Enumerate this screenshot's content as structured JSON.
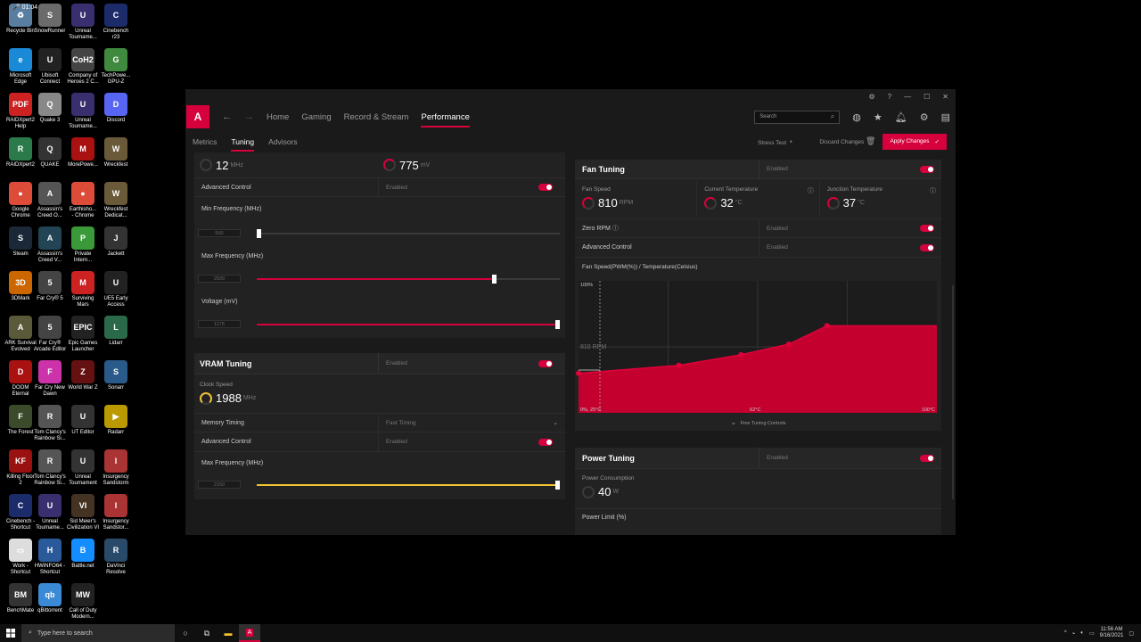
{
  "desktop": {
    "icons": [
      {
        "label": "Recycle Bin",
        "x": 3,
        "y": 4,
        "color": "#5a7ea0",
        "glyph": "♻"
      },
      {
        "label": "SnowRunner",
        "x": 36,
        "y": 4,
        "color": "#6b6b6b",
        "glyph": "S"
      },
      {
        "label": "Unreal\nTourname...",
        "x": 73,
        "y": 4,
        "color": "#3a2f6e",
        "glyph": "U"
      },
      {
        "label": "Cinebench\nr23",
        "x": 110,
        "y": 4,
        "color": "#1c2c6a",
        "glyph": "C"
      },
      {
        "label": "Microsoft\nEdge",
        "x": 3,
        "y": 54,
        "color": "#1b8ad6",
        "glyph": "e"
      },
      {
        "label": "Ubisoft\nConnect",
        "x": 36,
        "y": 54,
        "color": "#222",
        "glyph": "U"
      },
      {
        "label": "Company of\nHeroes 2 C...",
        "x": 73,
        "y": 54,
        "color": "#444",
        "glyph": "CoH2"
      },
      {
        "label": "TechPowe...\nGPU-Z",
        "x": 110,
        "y": 54,
        "color": "#3f8a3f",
        "glyph": "G"
      },
      {
        "label": "RAIDXpert2\nHelp",
        "x": 3,
        "y": 104,
        "color": "#c22",
        "glyph": "PDF"
      },
      {
        "label": "Quake 3",
        "x": 36,
        "y": 104,
        "color": "#888",
        "glyph": "Q"
      },
      {
        "label": "Unreal\nTourname...",
        "x": 73,
        "y": 104,
        "color": "#3a2f6e",
        "glyph": "U"
      },
      {
        "label": "Discord",
        "x": 110,
        "y": 104,
        "color": "#5865f2",
        "glyph": "D"
      },
      {
        "label": "RAIDXpert2",
        "x": 3,
        "y": 154,
        "color": "#2a7a4a",
        "glyph": "R"
      },
      {
        "label": "QUAKE",
        "x": 36,
        "y": 154,
        "color": "#333",
        "glyph": "Q"
      },
      {
        "label": "MorePowe...",
        "x": 73,
        "y": 154,
        "color": "#a11",
        "glyph": "M"
      },
      {
        "label": "Wreckfest",
        "x": 110,
        "y": 154,
        "color": "#6a5a3a",
        "glyph": "W"
      },
      {
        "label": "Google\nChrome",
        "x": 3,
        "y": 204,
        "color": "#dd4b39",
        "glyph": "●"
      },
      {
        "label": "Assassin's\nCreed O...",
        "x": 36,
        "y": 204,
        "color": "#555",
        "glyph": "A"
      },
      {
        "label": "Earthisho...\n- Chrome",
        "x": 73,
        "y": 204,
        "color": "#dd4b39",
        "glyph": "●"
      },
      {
        "label": "Wreckfest\nDedicat...",
        "x": 110,
        "y": 204,
        "color": "#6a5a3a",
        "glyph": "W"
      },
      {
        "label": "Steam",
        "x": 3,
        "y": 254,
        "color": "#1b2838",
        "glyph": "S"
      },
      {
        "label": "Assassin's\nCreed V...",
        "x": 36,
        "y": 254,
        "color": "#245",
        "glyph": "A"
      },
      {
        "label": "Private\nIntern...",
        "x": 73,
        "y": 254,
        "color": "#3a9a3a",
        "glyph": "P"
      },
      {
        "label": "Jackett",
        "x": 110,
        "y": 254,
        "color": "#333",
        "glyph": "J"
      },
      {
        "label": "3DMark",
        "x": 3,
        "y": 304,
        "color": "#c60",
        "glyph": "3D"
      },
      {
        "label": "Far Cry® 5",
        "x": 36,
        "y": 304,
        "color": "#444",
        "glyph": "5"
      },
      {
        "label": "Surviving\nMars",
        "x": 73,
        "y": 304,
        "color": "#c22",
        "glyph": "M"
      },
      {
        "label": "UE5 Early\nAccess",
        "x": 110,
        "y": 304,
        "color": "#222",
        "glyph": "U"
      },
      {
        "label": "ARK Survival\nEvolved",
        "x": 3,
        "y": 354,
        "color": "#5a5a3a",
        "glyph": "A"
      },
      {
        "label": "Far Cry®\nArcade Editor",
        "x": 36,
        "y": 354,
        "color": "#444",
        "glyph": "5"
      },
      {
        "label": "Epic Games\nLauncher",
        "x": 73,
        "y": 354,
        "color": "#222",
        "glyph": "EPIC"
      },
      {
        "label": "Lidarr",
        "x": 110,
        "y": 354,
        "color": "#2a6a4a",
        "glyph": "L"
      },
      {
        "label": "DOOM\nEternal",
        "x": 3,
        "y": 404,
        "color": "#a11",
        "glyph": "D"
      },
      {
        "label": "Far Cry New\nDawn",
        "x": 36,
        "y": 404,
        "color": "#c3a",
        "glyph": "F"
      },
      {
        "label": "World War Z",
        "x": 73,
        "y": 404,
        "color": "#611",
        "glyph": "Z"
      },
      {
        "label": "Sonarr",
        "x": 110,
        "y": 404,
        "color": "#2a5a8a",
        "glyph": "S"
      },
      {
        "label": "The Forest",
        "x": 3,
        "y": 454,
        "color": "#3a4a2a",
        "glyph": "F"
      },
      {
        "label": "Tom Clancy's\nRainbow Si...",
        "x": 36,
        "y": 454,
        "color": "#555",
        "glyph": "R"
      },
      {
        "label": "UT Editor",
        "x": 73,
        "y": 454,
        "color": "#333",
        "glyph": "U"
      },
      {
        "label": "Radarr",
        "x": 110,
        "y": 454,
        "color": "#b90",
        "glyph": "▶"
      },
      {
        "label": "Killing Floor\n2",
        "x": 3,
        "y": 504,
        "color": "#911",
        "glyph": "KF"
      },
      {
        "label": "Tom Clancy's\nRainbow Si...",
        "x": 36,
        "y": 504,
        "color": "#555",
        "glyph": "R"
      },
      {
        "label": "Unreal\nTournament",
        "x": 73,
        "y": 504,
        "color": "#333",
        "glyph": "U"
      },
      {
        "label": "Insurgency\nSandstorm",
        "x": 110,
        "y": 504,
        "color": "#a33",
        "glyph": "I"
      },
      {
        "label": "Cinebench -\nShortcut",
        "x": 3,
        "y": 554,
        "color": "#1c2c6a",
        "glyph": "C"
      },
      {
        "label": "Unreal\nTourname...",
        "x": 36,
        "y": 554,
        "color": "#3a2f6e",
        "glyph": "U"
      },
      {
        "label": "Sid Meier's\nCivilization VI",
        "x": 73,
        "y": 554,
        "color": "#432",
        "glyph": "VI"
      },
      {
        "label": "Insurgency\nSandstor...",
        "x": 110,
        "y": 554,
        "color": "#a33",
        "glyph": "I"
      },
      {
        "label": "Work -\nShortcut",
        "x": 3,
        "y": 604,
        "color": "#ddd",
        "glyph": "▭"
      },
      {
        "label": "HWiNFO64 -\nShortcut",
        "x": 36,
        "y": 604,
        "color": "#2a5a9a",
        "glyph": "H"
      },
      {
        "label": "Battle.net",
        "x": 73,
        "y": 604,
        "color": "#148eff",
        "glyph": "B"
      },
      {
        "label": "DaVinci\nResolve",
        "x": 110,
        "y": 604,
        "color": "#2a4a6a",
        "glyph": "R"
      },
      {
        "label": "BenchMate",
        "x": 3,
        "y": 654,
        "color": "#333",
        "glyph": "BM"
      },
      {
        "label": "qBittorrent",
        "x": 36,
        "y": 654,
        "color": "#3b8ad6",
        "glyph": "qb"
      },
      {
        "label": "Call of Duty\nModern...",
        "x": 73,
        "y": 654,
        "color": "#222",
        "glyph": "MW"
      }
    ],
    "recording_time": "01:04"
  },
  "taskbar": {
    "search_placeholder": "Type here to search",
    "time": "11:56 AM",
    "date": "9/16/2021"
  },
  "app": {
    "nav": {
      "logo": "A",
      "home": "Home",
      "gaming": "Gaming",
      "record": "Record & Stream",
      "performance": "Performance",
      "search_placeholder": "Search"
    },
    "subnav": {
      "metrics": "Metrics",
      "tuning": "Tuning",
      "advisors": "Advisors",
      "stress_test": "Stress Test",
      "discard": "Discard Changes",
      "apply": "Apply Changes"
    },
    "gpu": {
      "clock_value": "12",
      "clock_unit": "MHz",
      "voltage_value": "775",
      "voltage_unit": "mV",
      "advanced_control": "Advanced Control",
      "enabled": "Enabled",
      "min_freq_label": "Min Frequency (MHz)",
      "min_freq_value": "500",
      "max_freq_label": "Max Frequency (MHz)",
      "max_freq_value": "2509",
      "max_freq_fraction": 0.79,
      "voltage_label": "Voltage (mV)",
      "voltage_slider_value": "1175",
      "voltage_fraction": 1.0
    },
    "vram": {
      "title": "VRAM Tuning",
      "enabled": "Enabled",
      "clock_label": "Clock Speed",
      "clock_value": "1988",
      "clock_unit": "MHz",
      "memory_timing": "Memory Timing",
      "memory_timing_value": "Fast Timing",
      "advanced_control": "Advanced Control",
      "advanced_enabled": "Enabled",
      "max_freq_label": "Max Frequency (MHz)",
      "max_freq_value": "2150",
      "max_freq_fraction": 1.0
    },
    "fan": {
      "title": "Fan Tuning",
      "enabled": "Enabled",
      "fan_speed_label": "Fan Speed",
      "fan_speed_value": "810",
      "fan_speed_unit": "RPM",
      "current_temp_label": "Current Temperature",
      "current_temp_value": "32",
      "current_temp_unit": "°C",
      "junction_temp_label": "Junction Temperature",
      "junction_temp_value": "37",
      "junction_temp_unit": "°C",
      "zero_rpm": "Zero RPM",
      "zero_rpm_enabled": "Enabled",
      "advanced_control": "Advanced Control",
      "advanced_enabled": "Enabled",
      "curve_title": "Fan Speed(PWM(%)) / Temperature(Celsius)",
      "y_top": "100%",
      "y_origin": "0%, 25°C",
      "x_mid": "62°C",
      "x_max": "100°C",
      "rpm_overlay": "810 RPM",
      "fine_tuning": "Fine Tuning Controls"
    },
    "power": {
      "title": "Power Tuning",
      "enabled": "Enabled",
      "consumption_label": "Power Consumption",
      "consumption_value": "40",
      "consumption_unit": "W",
      "limit_label": "Power Limit (%)"
    }
  },
  "chart_data": {
    "type": "area",
    "xlabel": "Temperature(Celsius)",
    "ylabel": "Fan Speed(PWM(%))",
    "xlim": [
      25,
      100
    ],
    "ylim": [
      0,
      100
    ],
    "x": [
      25,
      46,
      59,
      69,
      77,
      100
    ],
    "y": [
      30,
      36,
      44,
      52,
      66,
      66
    ]
  }
}
